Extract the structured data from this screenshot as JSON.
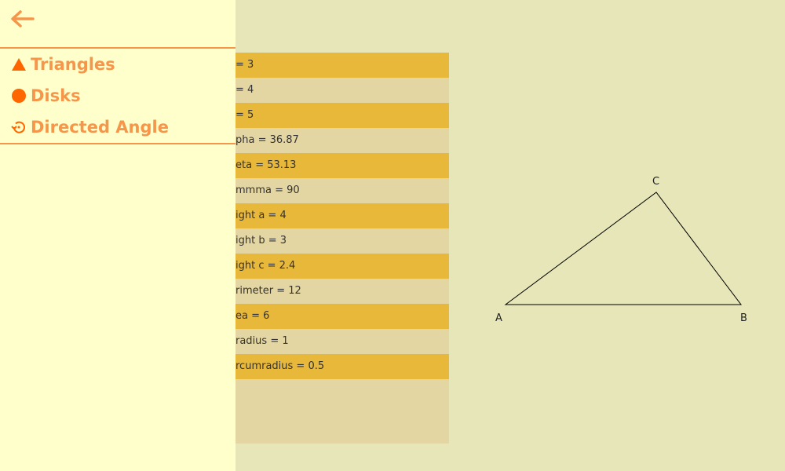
{
  "sidebar": {
    "back_icon": "arrow-left-icon",
    "items": [
      {
        "label": "Triangles",
        "icon": "triangle-icon"
      },
      {
        "label": "Disks",
        "icon": "disk-icon"
      },
      {
        "label": "Directed Angle",
        "icon": "rotate-icon"
      }
    ]
  },
  "properties": [
    "= 3",
    "= 4",
    "= 5",
    "pha = 36.87",
    "eta = 53.13",
    "mmma = 90",
    "ight a = 4",
    "ight b = 3",
    "ight c = 2.4",
    "rimeter = 12",
    "ea = 6",
    "radius = 1",
    "rcumradius = 0.5"
  ],
  "triangle": {
    "labels": {
      "a": "A",
      "b": "B",
      "c": "C"
    }
  },
  "colors": {
    "accent": "#f5964a",
    "icon": "#ff6600",
    "row_highlight": "#e8b83b",
    "row_alt": "#e4d6a2",
    "sidebar_bg": "#ffffcc",
    "canvas_bg": "#e6e6b8"
  }
}
